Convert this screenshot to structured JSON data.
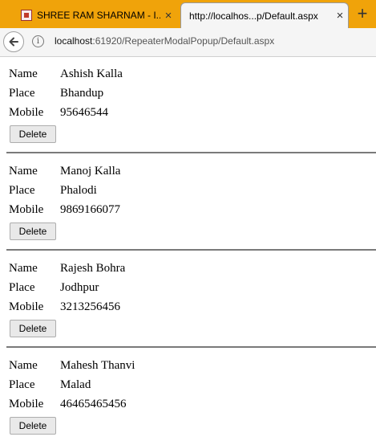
{
  "tabs": [
    {
      "title": "SHREE RAM SHARNAM - I...",
      "active": false
    },
    {
      "title": "http://localhos...p/Default.aspx",
      "active": true
    }
  ],
  "address_bar": {
    "host": "localhost",
    "path": ":61920/RepeaterModalPopup/Default.aspx"
  },
  "icons": {
    "tab_close": "×",
    "new_tab": "+",
    "info": "i"
  },
  "labels": {
    "name": "Name",
    "place": "Place",
    "mobile": "Mobile",
    "delete": "Delete"
  },
  "records": [
    {
      "name": "Ashish Kalla",
      "place": "Bhandup",
      "mobile": "95646544"
    },
    {
      "name": "Manoj Kalla",
      "place": "Phalodi",
      "mobile": "9869166077"
    },
    {
      "name": "Rajesh Bohra",
      "place": "Jodhpur",
      "mobile": "3213256456"
    },
    {
      "name": "Mahesh Thanvi",
      "place": "Malad",
      "mobile": "46465465456"
    }
  ],
  "colors": {
    "tabstrip_bg": "#f0a30a",
    "divider": "#7a7a7a"
  }
}
